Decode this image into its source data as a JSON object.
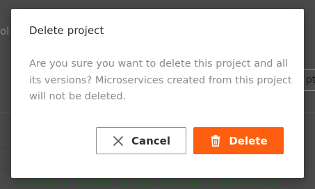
{
  "background": {
    "top_fragment": "ol",
    "right_button_fragment": "pt",
    "code_lines": [
      "<",
      ".",
      "Create a folder in the Pictures directory."
    ]
  },
  "dialog": {
    "title": "Delete project",
    "message": "Are you sure you want to delete this project and all its versions? Microservices created from this project will not be deleted.",
    "cancel_label": "Cancel",
    "delete_label": "Delete",
    "cancel_icon": "close-icon",
    "delete_icon": "trash-icon"
  },
  "colors": {
    "delete_button": "#fe5e0f",
    "overlay": "#4a4a4a"
  }
}
